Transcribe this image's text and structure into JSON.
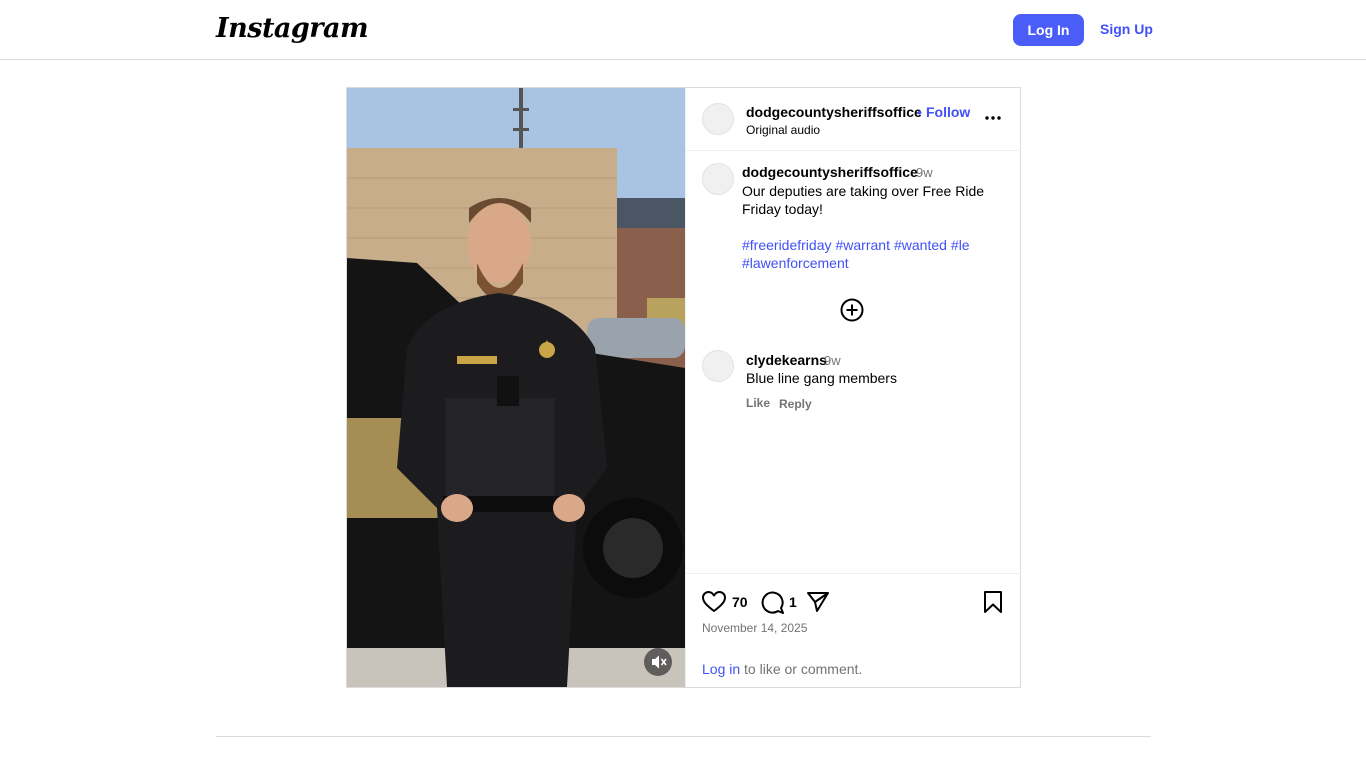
{
  "header": {
    "logo": "Instagram",
    "login_label": "Log In",
    "signup_label": "Sign Up"
  },
  "post": {
    "author": "dodgecountysheriffsoffice",
    "separator": "•",
    "follow_label": "Follow",
    "audio": "Original audio",
    "caption": {
      "user": "dodgecountysheriffsoffice",
      "time": "9w",
      "text": "Our deputies are taking over Free Ride Friday today!",
      "hashtags": [
        "#freeridefriday",
        "#warrant",
        "#wanted",
        "#le",
        "#lawenforcement"
      ]
    },
    "comment": {
      "user": "clydekearns",
      "time": "9w",
      "text": "Blue line gang members",
      "like_label": "Like",
      "reply_label": "Reply"
    },
    "likes": "70",
    "comments": "1",
    "date": "November 14, 2025",
    "login_link": "Log in",
    "login_suffix": " to like or comment."
  },
  "icons": {
    "more": "more-options-icon",
    "add": "add-circle-icon",
    "like": "heart-icon",
    "comment": "comment-icon",
    "share": "share-icon",
    "save": "bookmark-icon",
    "mute": "muted-speaker-icon"
  },
  "colors": {
    "accent": "#4a5df9",
    "link": "#4150f7",
    "muted_text": "#737373"
  }
}
